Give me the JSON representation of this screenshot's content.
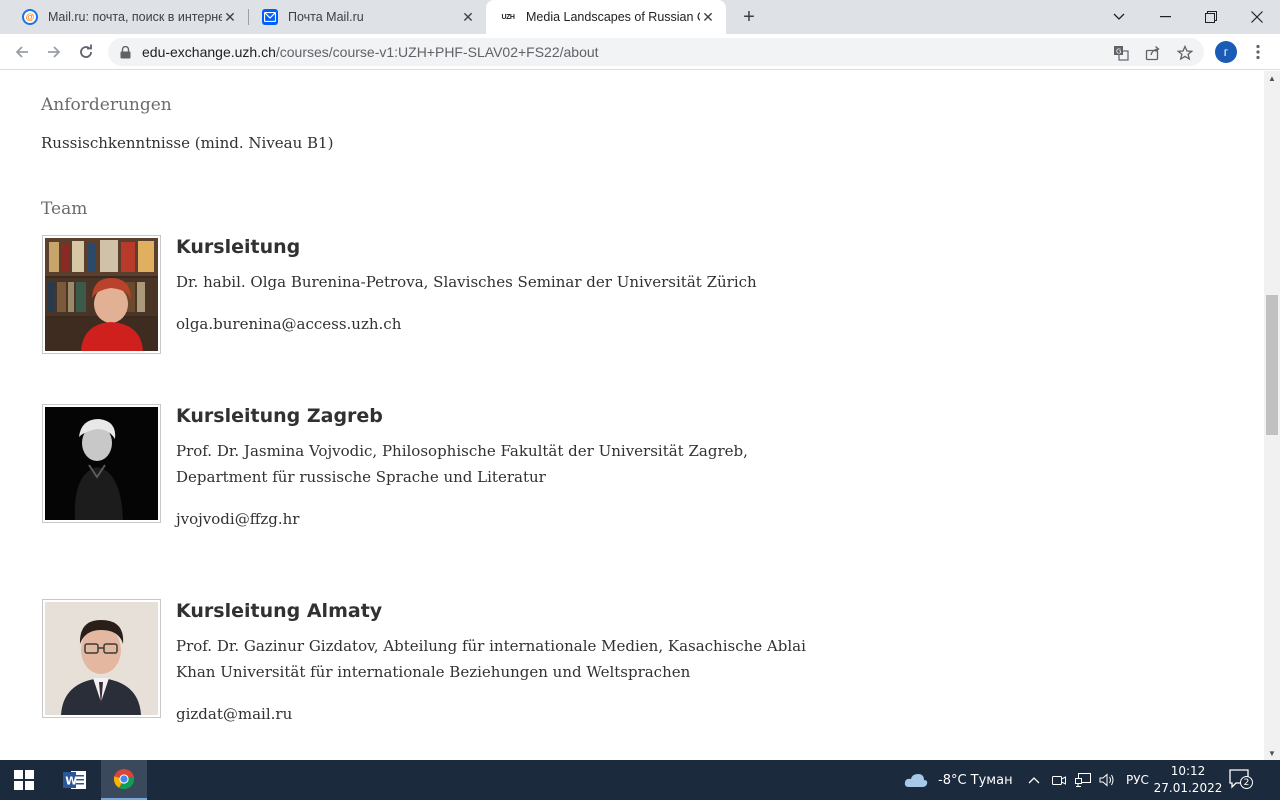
{
  "browser": {
    "tabs": [
      {
        "title": "Mail.ru: почта, поиск в интернете, новости, игры",
        "favicon": "mailru-icon"
      },
      {
        "title": "Почта Mail.ru",
        "favicon": "pochta-icon"
      },
      {
        "title": "Media Landscapes of Russian Culture",
        "favicon": "uzh-icon",
        "favicon_text": "UZH",
        "active": true
      }
    ],
    "url_host": "edu-exchange.uzh.ch",
    "url_path": "/courses/course-v1:UZH+PHF-SLAV02+FS22/about",
    "profile_initial": "г"
  },
  "content": {
    "requirements_heading": "Anforderungen",
    "requirements_text": "Russischkenntnisse (mind. Niveau B1)",
    "team_heading": "Team",
    "members": [
      {
        "role": "Kursleitung",
        "description": "Dr. habil. Olga Burenina-Petrova, Slavisches Seminar der Universität Zürich",
        "email": "olga.burenina@access.uzh.ch"
      },
      {
        "role": "Kursleitung Zagreb",
        "description": "Prof. Dr. Jasmina Vojvodic, Philosophische Fakultät der Universität Zagreb, Department für russische Sprache und Literatur",
        "email": "jvojvodi@ffzg.hr"
      },
      {
        "role": "Kursleitung Almaty",
        "description": "Prof. Dr. Gazinur Gizdatov, Abteilung für internationale Medien, Kasachische Ablai Khan Universität für internationale Beziehungen und Weltsprachen",
        "email": "gizdat@mail.ru"
      }
    ]
  },
  "taskbar": {
    "weather": "-8°C  Туман",
    "language": "РУС",
    "time": "10:12",
    "date": "27.01.2022",
    "notification_count": "2",
    "word_label": "W"
  },
  "colors": {
    "tabstrip": "#dee1e6",
    "taskbar": "#1b2a3c",
    "text": "#313131",
    "heading_muted": "#6b6b6b",
    "profile": "#1a5bb5"
  }
}
